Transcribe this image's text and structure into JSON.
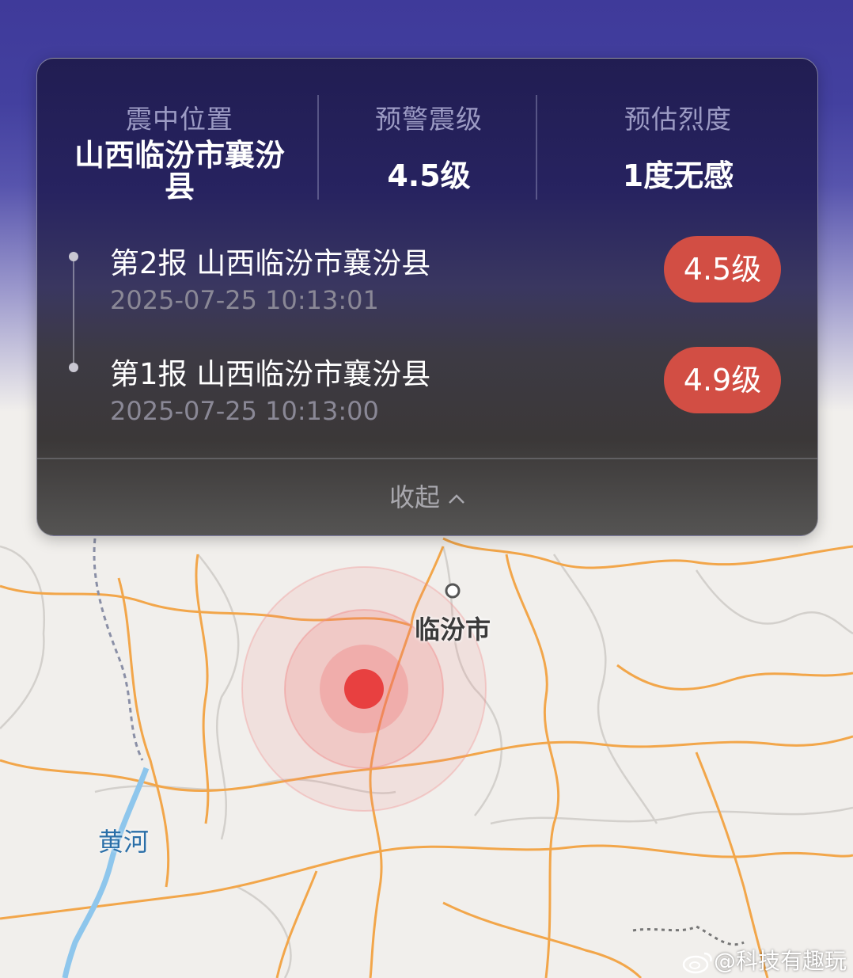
{
  "summary": {
    "epicenter_label": "震中位置",
    "epicenter_value": "山西临汾市襄汾县",
    "magnitude_label": "预警震级",
    "magnitude_value": "4.5级",
    "intensity_label": "预估烈度",
    "intensity_value": "1度无感"
  },
  "reports": [
    {
      "title": "第2报 山西临汾市襄汾县",
      "time": "2025-07-25 10:13:01",
      "magnitude": "4.5级"
    },
    {
      "title": "第1报 山西临汾市襄汾县",
      "time": "2025-07-25 10:13:00",
      "magnitude": "4.9级"
    }
  ],
  "collapse_label": "收起",
  "map": {
    "city_label": "临汾市",
    "river_label": "黄河",
    "road_color": "#f2a64a",
    "river_color": "#8ec6ec",
    "epicenter_color": "#e84040"
  },
  "watermark": "@科技有趣玩"
}
